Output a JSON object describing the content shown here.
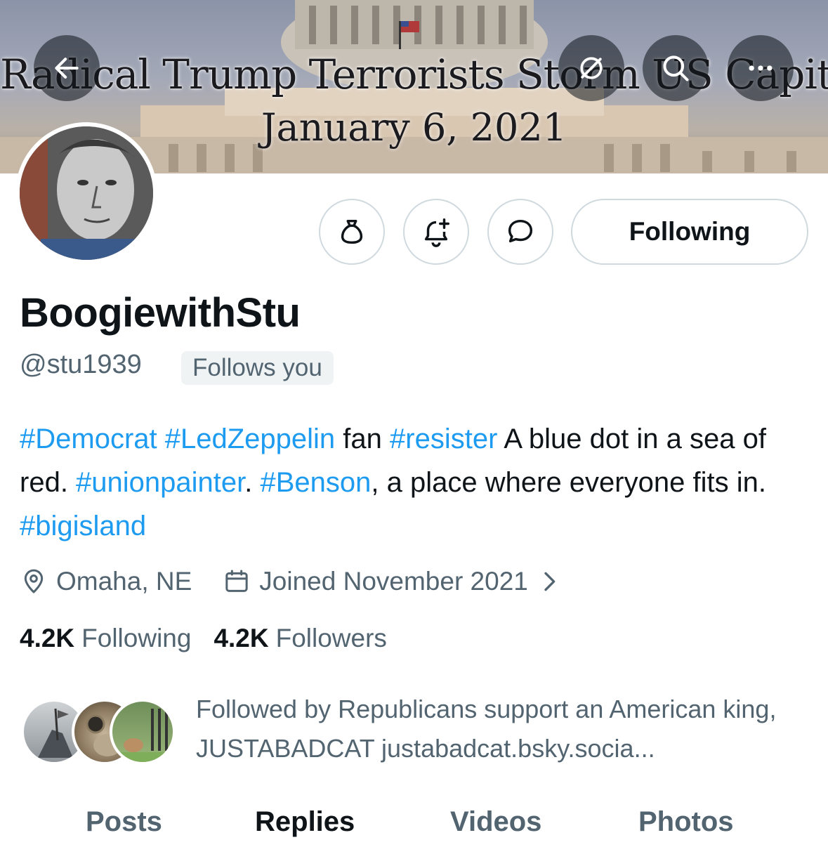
{
  "banner": {
    "line1": "Radical Trump Terrorists Storm US Capitol",
    "line2": "January 6, 2021"
  },
  "top_buttons": {
    "back_icon": "arrow-left-icon",
    "grok_icon": "grok-icon",
    "search_icon": "search-icon",
    "more_icon": "more-icon"
  },
  "actions": {
    "tip_icon": "money-bag-icon",
    "notify_icon": "bell-plus-icon",
    "message_icon": "message-icon",
    "following_label": "Following"
  },
  "profile": {
    "display_name": "BoogiewithStu",
    "handle": "@stu1939",
    "follows_you": "Follows you"
  },
  "bio": {
    "t1": "#Democrat",
    "t2": " ",
    "t3": "#LedZeppelin",
    "t4": " fan ",
    "t5": "#resister",
    "t6": " A blue dot in a sea of red. ",
    "t7": "#unionpainter",
    "t8": ". ",
    "t9": "#Benson",
    "t10": ", a place where everyone fits in. ",
    "t11": "#bigisland"
  },
  "meta": {
    "location": "Omaha, NE",
    "joined": "Joined November 2021"
  },
  "counts": {
    "following_count": "4.2K",
    "following_label": "Following",
    "followers_count": "4.2K",
    "followers_label": "Followers"
  },
  "followed_by": "Followed by Republicans support an American king, JUSTABADCAT justabadcat.bsky.socia...",
  "tabs": [
    {
      "label": "Posts"
    },
    {
      "label": "Replies"
    },
    {
      "label": "Videos"
    },
    {
      "label": "Photos"
    }
  ],
  "colors": {
    "accent": "#1d9bf0",
    "secondary_text": "#536471",
    "primary_text": "#0f1419",
    "border": "#cfd9de"
  }
}
